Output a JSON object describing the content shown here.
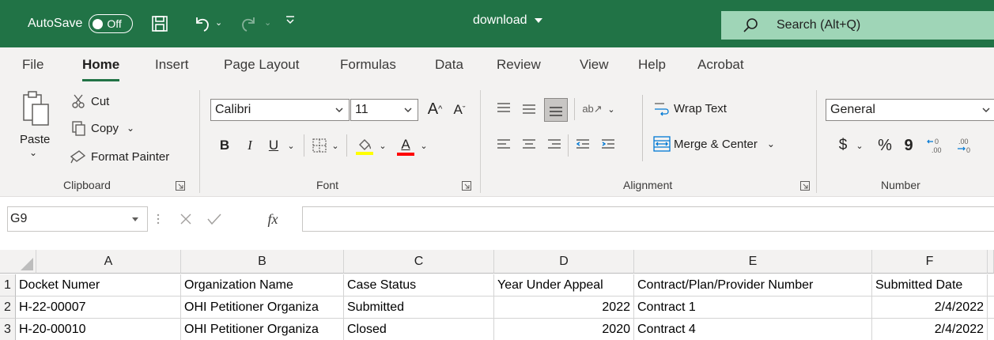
{
  "titlebar": {
    "autosave_label": "AutoSave",
    "autosave_state": "Off",
    "doc_title": "download",
    "search_placeholder": "Search (Alt+Q)",
    "brand_color": "#217346"
  },
  "tabs": [
    "File",
    "Home",
    "Insert",
    "Page Layout",
    "Formulas",
    "Data",
    "Review",
    "View",
    "Help",
    "Acrobat"
  ],
  "active_tab": "Home",
  "ribbon": {
    "clipboard": {
      "paste": "Paste",
      "cut": "Cut",
      "copy": "Copy",
      "format_painter": "Format Painter",
      "group": "Clipboard"
    },
    "font": {
      "font_name": "Calibri",
      "font_size": "11",
      "bold": "B",
      "italic": "I",
      "underline": "U",
      "group": "Font",
      "highlight_color": "#ffff00",
      "font_color": "#ff0000"
    },
    "alignment": {
      "wrap_text": "Wrap Text",
      "merge_center": "Merge & Center",
      "group": "Alignment"
    },
    "number": {
      "format": "General",
      "currency": "$",
      "percent": "%",
      "comma": "9",
      "group": "Number"
    }
  },
  "formula_bar": {
    "name_box": "G9",
    "fx": "fx",
    "content": ""
  },
  "grid": {
    "columns": [
      "A",
      "B",
      "C",
      "D",
      "E",
      "F"
    ],
    "rows": [
      {
        "num": "1",
        "cells": [
          "Docket Numer",
          "Organization Name",
          "Case Status",
          "Year Under Appeal",
          "Contract/Plan/Provider Number",
          "Submitted Date"
        ]
      },
      {
        "num": "2",
        "cells": [
          "H-22-00007",
          "OHI Petitioner Organiza",
          "Submitted",
          "2022",
          "Contract 1",
          "2/4/2022"
        ]
      },
      {
        "num": "3",
        "cells": [
          "H-20-00010",
          "OHI Petitioner Organiza",
          "Closed",
          "2020",
          "Contract 4",
          "2/4/2022"
        ]
      }
    ]
  }
}
